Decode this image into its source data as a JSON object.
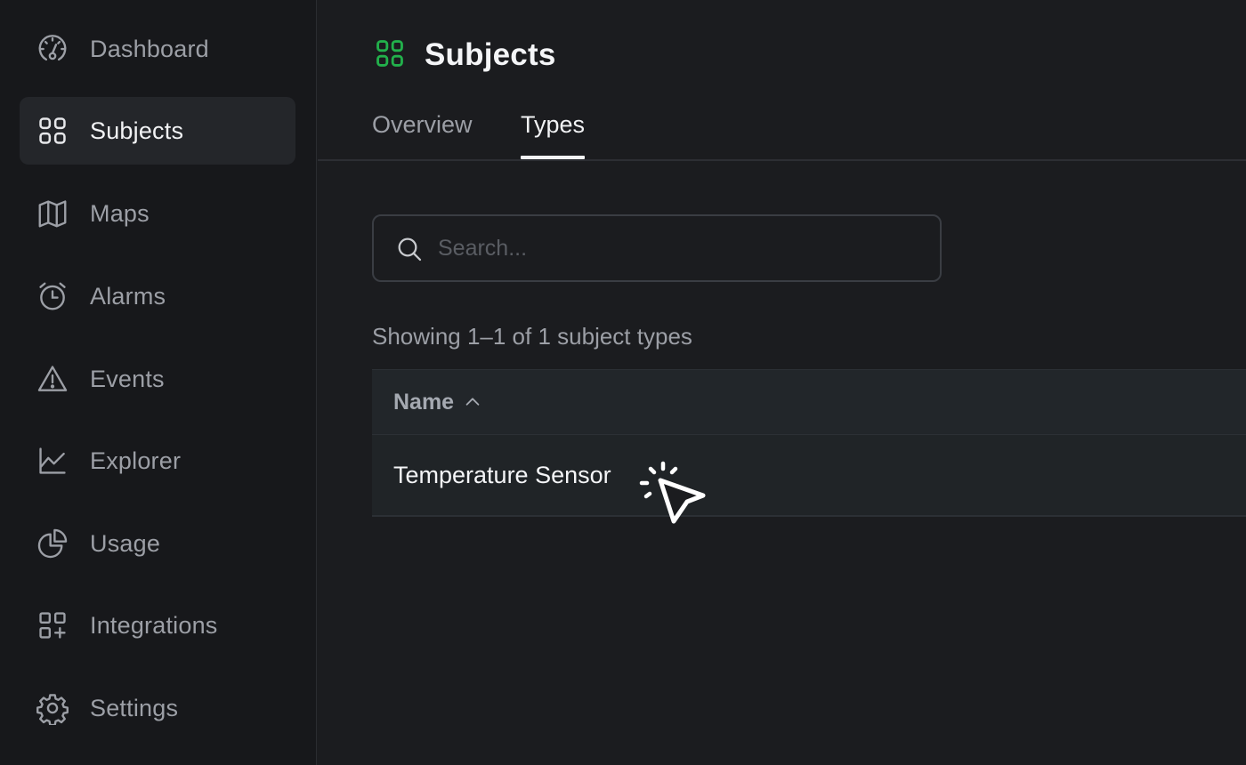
{
  "sidebar": {
    "items": [
      {
        "label": "Dashboard",
        "icon": "gauge-icon",
        "active": false
      },
      {
        "label": "Subjects",
        "icon": "grid-icon",
        "active": true
      },
      {
        "label": "Maps",
        "icon": "map-icon",
        "active": false
      },
      {
        "label": "Alarms",
        "icon": "alarm-clock-icon",
        "active": false
      },
      {
        "label": "Events",
        "icon": "warning-triangle-icon",
        "active": false
      },
      {
        "label": "Explorer",
        "icon": "line-chart-icon",
        "active": false
      },
      {
        "label": "Usage",
        "icon": "pie-chart-icon",
        "active": false
      },
      {
        "label": "Integrations",
        "icon": "apps-add-icon",
        "active": false
      },
      {
        "label": "Settings",
        "icon": "gear-icon",
        "active": false
      }
    ]
  },
  "header": {
    "title": "Subjects",
    "icon": "grid-icon",
    "accent_color": "#22b04b"
  },
  "tabs": [
    {
      "label": "Overview",
      "active": false
    },
    {
      "label": "Types",
      "active": true
    }
  ],
  "search": {
    "placeholder": "Search...",
    "value": ""
  },
  "results_text": "Showing 1–1 of 1 subject types",
  "table": {
    "columns": [
      {
        "label": "Name",
        "sort": "ascending"
      }
    ],
    "rows": [
      {
        "name": "Temperature Sensor"
      }
    ]
  }
}
